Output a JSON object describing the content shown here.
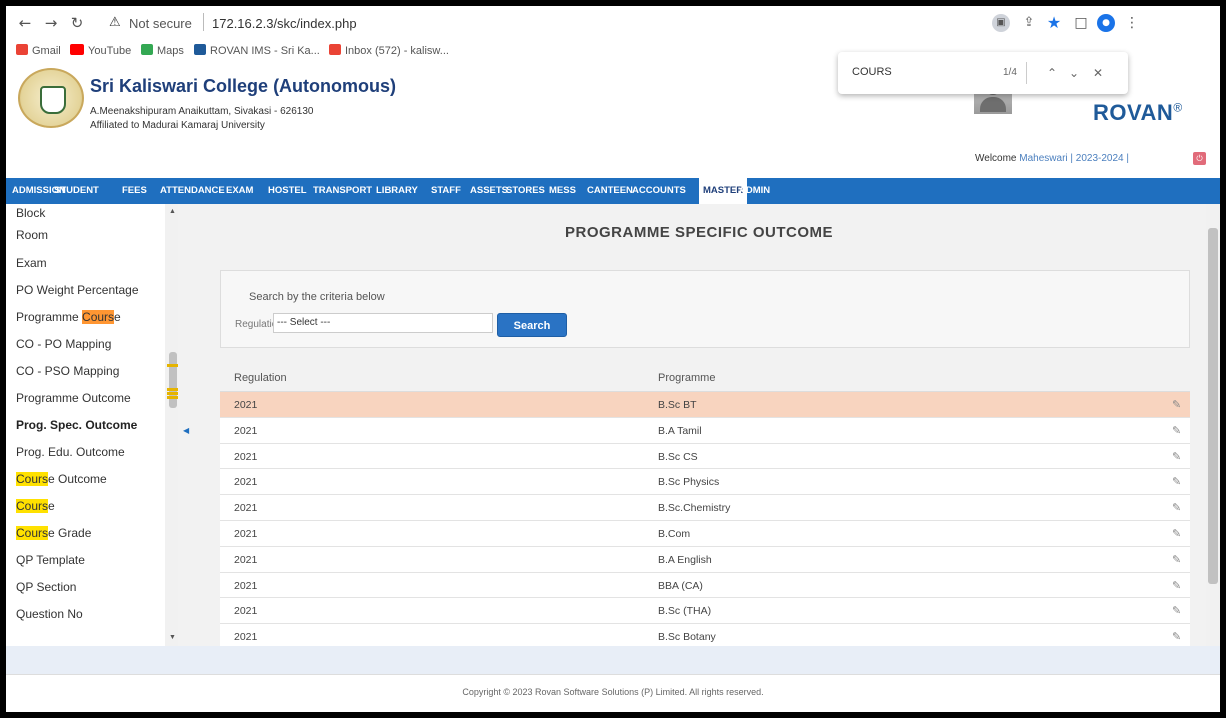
{
  "browser": {
    "security_label": "Not secure",
    "url": "172.16.2.3/skc/index.php",
    "bookmarks": [
      "Gmail",
      "YouTube",
      "Maps",
      "ROVAN IMS - Sri Ka...",
      "Inbox (572) - kalisw..."
    ]
  },
  "find": {
    "query": "COURS",
    "count": "1/4"
  },
  "header": {
    "college_name": "Sri Kaliswari College (Autonomous)",
    "address": "A.Meenakshipuram Anaikuttam, Sivakasi - 626130",
    "affiliation": "Affiliated to Madurai Kamaraj University",
    "brand": "ROVAN",
    "brand_mark": "®",
    "welcome": "Welcome",
    "user": "Maheswari",
    "year": "| 2023-2024 |"
  },
  "nav": [
    "ADMISSION",
    "STUDENT",
    "FEES",
    "ATTENDANCE",
    "EXAM",
    "HOSTEL",
    "TRANSPORT",
    "LIBRARY",
    "STAFF",
    "ASSETS",
    "STORES",
    "MESS",
    "CANTEEN",
    "ACCOUNTS",
    "MASTER",
    "ADMIN"
  ],
  "nav_active": "MASTER",
  "sidebar": {
    "items": [
      {
        "label": "Block"
      },
      {
        "label": "Room"
      },
      {
        "label": "Exam"
      },
      {
        "label": "PO Weight Percentage"
      },
      {
        "pre": "Programme ",
        "hl": "Cours",
        "post": "e",
        "hl_class": "hl-cur"
      },
      {
        "label": "CO - PO Mapping"
      },
      {
        "label": "CO - PSO Mapping"
      },
      {
        "label": "Programme Outcome"
      },
      {
        "label": "Prog. Spec. Outcome",
        "active": true
      },
      {
        "label": "Prog. Edu. Outcome"
      },
      {
        "pre": "",
        "hl": "Cours",
        "post": "e Outcome",
        "hl_class": "hl"
      },
      {
        "pre": "",
        "hl": "Cours",
        "post": "e",
        "hl_class": "hl"
      },
      {
        "pre": "",
        "hl": "Cours",
        "post": "e Grade",
        "hl_class": "hl"
      },
      {
        "label": "QP Template"
      },
      {
        "label": "QP Section"
      },
      {
        "label": "Question No"
      }
    ]
  },
  "page": {
    "title": "PROGRAMME SPECIFIC OUTCOME",
    "search_caption": "Search by the criteria below",
    "regulation_label": "Regulation",
    "regulation_value": "--- Select ---",
    "search_button": "Search"
  },
  "table": {
    "headers": [
      "Regulation",
      "Programme"
    ],
    "rows": [
      [
        "2021",
        "B.Sc BT"
      ],
      [
        "2021",
        "B.A Tamil"
      ],
      [
        "2021",
        "B.Sc CS"
      ],
      [
        "2021",
        "B.Sc Physics"
      ],
      [
        "2021",
        "B.Sc.Chemistry"
      ],
      [
        "2021",
        "B.Com"
      ],
      [
        "2021",
        "B.A English"
      ],
      [
        "2021",
        "BBA (CA)"
      ],
      [
        "2021",
        "B.Sc (THA)"
      ],
      [
        "2021",
        "B.Sc Botany"
      ]
    ],
    "selected_row": 0
  },
  "footer": {
    "copyright": "Copyright © 2023 Rovan Software Solutions (P) Limited. All rights reserved."
  }
}
